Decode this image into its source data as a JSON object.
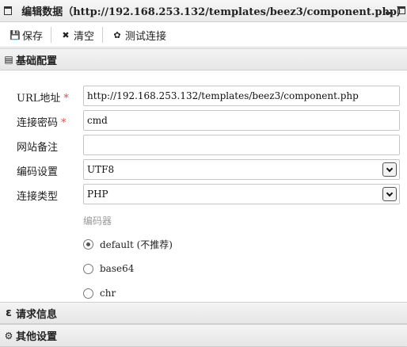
{
  "window": {
    "title": "编辑数据（http://192.168.253.132/templates/beez3/component.php）"
  },
  "toolbar": {
    "save_label": "保存",
    "clear_label": "清空",
    "test_label": "测试连接"
  },
  "sections": {
    "basic": "基础配置",
    "request": "请求信息",
    "other": "其他设置"
  },
  "form": {
    "url": {
      "label": "URL地址",
      "value": "http://192.168.253.132/templates/beez3/component.php",
      "required_mark": "*"
    },
    "password": {
      "label": "连接密码",
      "value": "cmd",
      "required_mark": "*"
    },
    "note": {
      "label": "网站备注",
      "value": ""
    },
    "encoding": {
      "label": "编码设置",
      "value": "UTF8"
    },
    "type": {
      "label": "连接类型",
      "value": "PHP"
    }
  },
  "encoder": {
    "label": "编码器",
    "options": [
      {
        "label": "default (不推荐)",
        "checked": true
      },
      {
        "label": "base64",
        "checked": false
      },
      {
        "label": "chr",
        "checked": false
      }
    ]
  },
  "colors": {
    "required": "#d9534f",
    "hint": "#9a9a9a"
  }
}
